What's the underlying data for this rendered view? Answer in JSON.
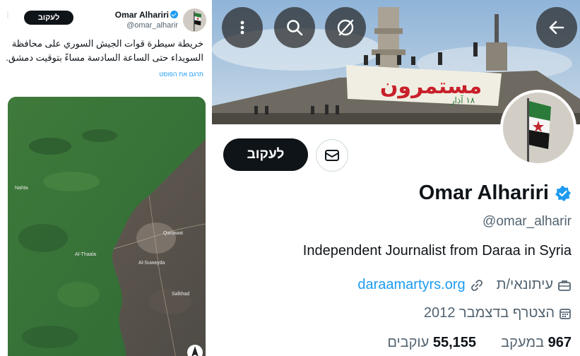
{
  "tweet": {
    "author_name": "Omar Alhariri",
    "author_handle": "@omar_alharir",
    "follow_label": "לעקוב",
    "more_label": "⋮",
    "text": "خريطة سيطرة قوات الجيش السوري على محافظة السويداء حتى الساعة السادسة مساءً بتوقيت دمشق.",
    "translate_label": "תרגם את הפוסט",
    "map_labels": [
      "Nahta",
      "Al-Thaala",
      "Al-Suwayda",
      "Qanawat",
      "Salkhad"
    ]
  },
  "profile": {
    "banner_text": "مستمرون",
    "banner_subtext": "١٨ آذار",
    "follow_label": "לעקוב",
    "name": "Omar Alhariri",
    "handle": "@omar_alharir",
    "bio": "Independent Journalist from Daraa in Syria",
    "profession": "עיתונאי/ת",
    "website": "daraamartyrs.org",
    "joined": "הצטרף בדצמבר 2012",
    "following_count": "967",
    "following_label": "במעקב",
    "followers_count": "55,155",
    "followers_label": "עוקבים"
  },
  "icons": {
    "back": "arrow-left-icon",
    "search": "search-icon",
    "mute": "slash-circle-icon",
    "more": "more-vertical-icon",
    "message": "envelope-icon",
    "verified": "verified-badge-icon",
    "link": "link-icon",
    "briefcase": "briefcase-icon",
    "calendar": "calendar-icon"
  },
  "colors": {
    "accent": "#1d9bf0",
    "follow_button": "#0f1419",
    "secondary_text": "#536471"
  }
}
